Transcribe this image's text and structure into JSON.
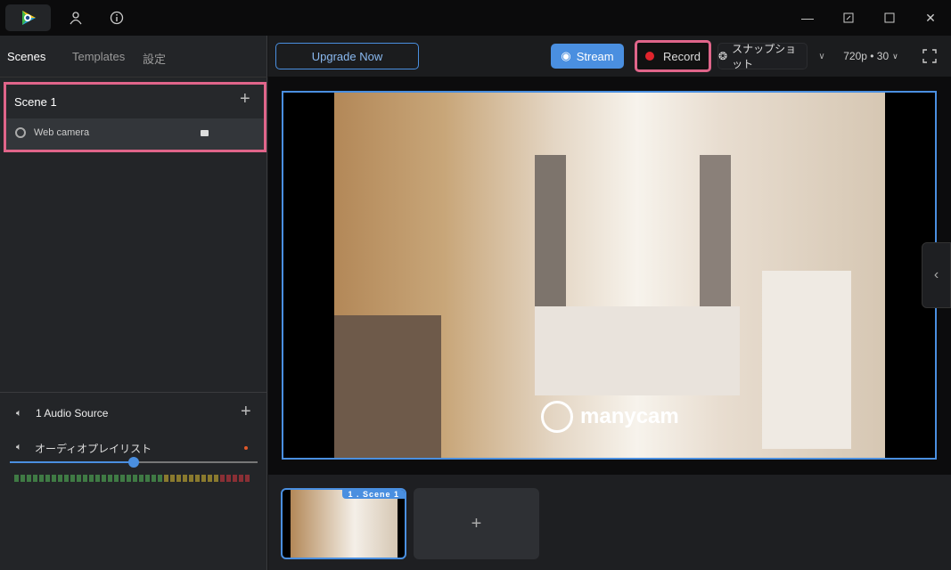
{
  "topbar": {
    "icons": [
      "app-logo",
      "user-icon",
      "info-icon"
    ],
    "window": [
      "minimize",
      "restore-small",
      "maximize",
      "close"
    ]
  },
  "left": {
    "tabs": [
      "Scenes",
      "Templates",
      "設定"
    ],
    "active_tab": "Scenes",
    "scene": {
      "title": "Scene 1",
      "add": "+",
      "sources": [
        {
          "label": "Web camera",
          "icon": "webcam-icon",
          "locked": true
        }
      ]
    },
    "audio": {
      "title": "1 Audio Source",
      "add": "+",
      "sources": [
        {
          "label": "オーディオプレイリスト",
          "volume": 0.5
        }
      ],
      "meter": {
        "green": 24,
        "yellow": 9,
        "red": 5
      }
    }
  },
  "toolbar": {
    "upgrade": "Upgrade Now",
    "stream": "Stream",
    "record": "Record",
    "snapshot": "スナップショット",
    "resolution": "720p • 30"
  },
  "preview": {
    "watermark": "manycam"
  },
  "scenes_strip": {
    "thumb_label": "1 . Scene 1",
    "add": "+"
  },
  "colors": {
    "accent": "#4a8fe0",
    "highlight": "#e0658a",
    "record": "#e0242c"
  }
}
